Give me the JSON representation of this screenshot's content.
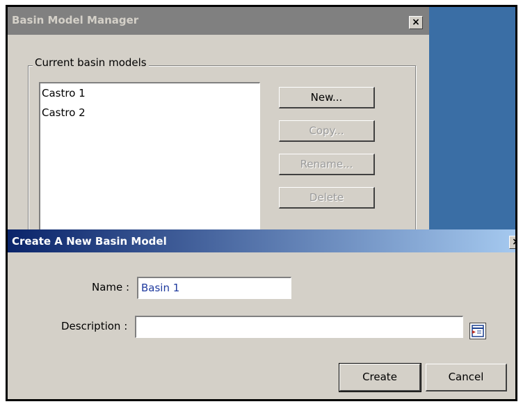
{
  "manager": {
    "title": "Basin Model Manager",
    "close_glyph": "×",
    "group_label": "Current basin models",
    "models": [
      "Castro 1",
      "Castro 2"
    ],
    "buttons": {
      "new": "New...",
      "copy": "Copy...",
      "rename": "Rename...",
      "delete": "Delete"
    }
  },
  "dialog": {
    "title": "Create A New Basin Model",
    "close_glyph": "×",
    "name_label": "Name :",
    "name_value": "Basin 1",
    "description_label": "Description :",
    "description_value": "",
    "browse_icon": "description-editor-icon",
    "create_label": "Create",
    "cancel_label": "Cancel"
  },
  "colors": {
    "desktop": "#3a6ea5",
    "window_face": "#d4d0c8",
    "active_title": "#0a246a",
    "inactive_title": "#808080"
  }
}
